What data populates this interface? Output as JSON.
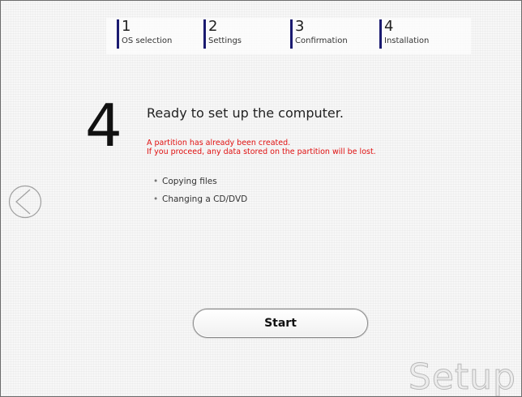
{
  "steps": [
    {
      "number": "1",
      "label": "OS selection"
    },
    {
      "number": "2",
      "label": "Settings"
    },
    {
      "number": "3",
      "label": "Confirmation"
    },
    {
      "number": "4",
      "label": "Installation"
    }
  ],
  "main": {
    "step_number": "4",
    "heading": "Ready to set up the computer.",
    "warning_line1": "A partition has already been created.",
    "warning_line2": "If you proceed, any data stored on the partition will be lost.",
    "tasks": [
      "Copying files",
      "Changing a CD/DVD"
    ]
  },
  "nav": {
    "back_icon": "chevron-left-circle-icon"
  },
  "buttons": {
    "start_label": "Start"
  },
  "watermark": "Setup",
  "colors": {
    "step_marker": "#1a1a70",
    "warning": "#e01010"
  }
}
